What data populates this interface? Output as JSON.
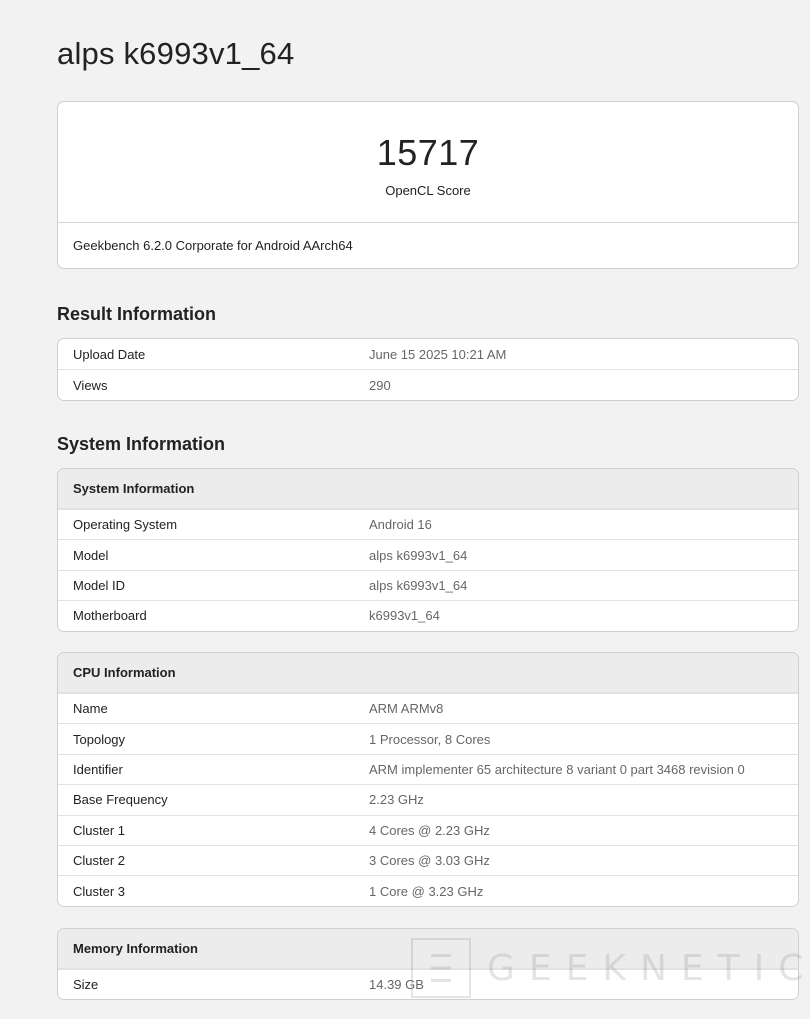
{
  "page": {
    "title": "alps k6993v1_64"
  },
  "score": {
    "value": "15717",
    "label": "OpenCL Score",
    "footer": "Geekbench 6.2.0 Corporate for Android AArch64"
  },
  "result_information": {
    "heading": "Result Information",
    "rows": [
      {
        "key": "Upload Date",
        "value": "June 15 2025 10:21 AM"
      },
      {
        "key": "Views",
        "value": "290"
      }
    ]
  },
  "system_information": {
    "heading": "System Information",
    "system_table": {
      "title": "System Information",
      "rows": [
        {
          "key": "Operating System",
          "value": "Android 16"
        },
        {
          "key": "Model",
          "value": "alps k6993v1_64"
        },
        {
          "key": "Model ID",
          "value": "alps k6993v1_64"
        },
        {
          "key": "Motherboard",
          "value": "k6993v1_64"
        }
      ]
    },
    "cpu_table": {
      "title": "CPU Information",
      "rows": [
        {
          "key": "Name",
          "value": "ARM ARMv8"
        },
        {
          "key": "Topology",
          "value": "1 Processor, 8 Cores"
        },
        {
          "key": "Identifier",
          "value": "ARM implementer 65 architecture 8 variant 0 part 3468 revision 0"
        },
        {
          "key": "Base Frequency",
          "value": "2.23 GHz"
        },
        {
          "key": "Cluster 1",
          "value": "4 Cores @ 2.23 GHz"
        },
        {
          "key": "Cluster 2",
          "value": "3 Cores @ 3.03 GHz"
        },
        {
          "key": "Cluster 3",
          "value": "1 Core @ 3.23 GHz"
        }
      ]
    },
    "memory_table": {
      "title": "Memory Information",
      "rows": [
        {
          "key": "Size",
          "value": "14.39 GB"
        }
      ]
    }
  },
  "watermark": {
    "text": "GEEKNETIC",
    "glyph": "Ξ"
  }
}
